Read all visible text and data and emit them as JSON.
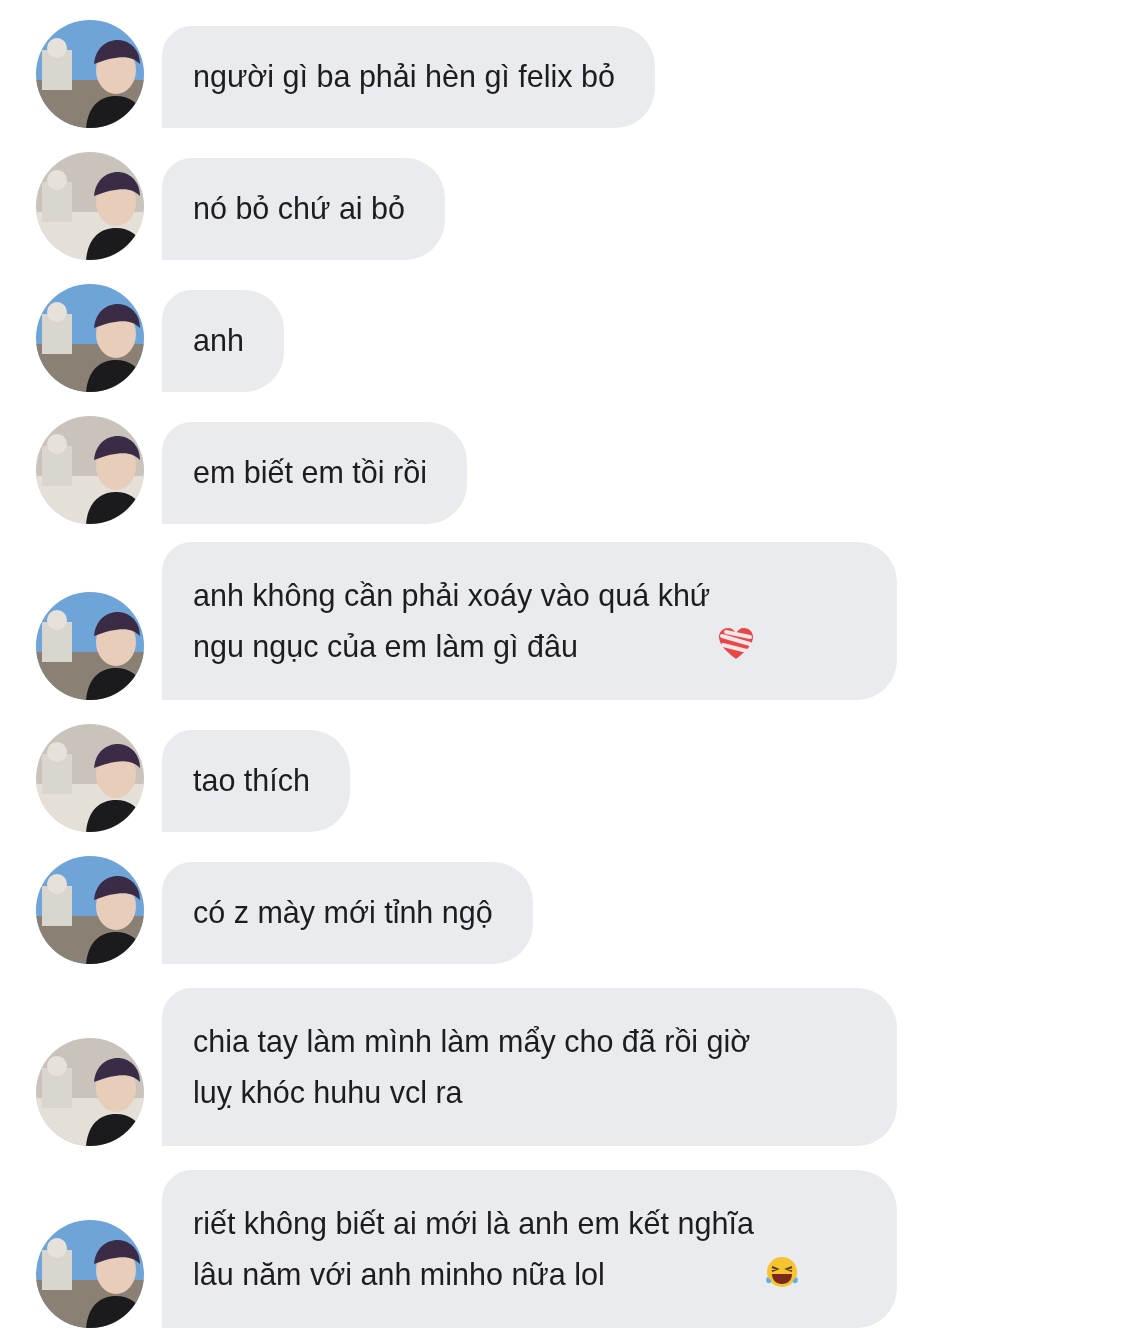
{
  "messages": [
    {
      "kind": "plain",
      "text": "người gì ba phải hèn gì felix bỏ"
    },
    {
      "kind": "plain",
      "text": "nó bỏ chứ ai bỏ"
    },
    {
      "kind": "plain",
      "text": "anh"
    },
    {
      "kind": "plain",
      "text": "em biết em tồi rồi"
    },
    {
      "kind": "heart",
      "text": "anh không cần phải xoáy vào quá khứ\nngu ngục của em làm gì đâu"
    },
    {
      "kind": "plain",
      "text": "tao thích"
    },
    {
      "kind": "plain",
      "text": "có z mày mới tỉnh ngộ"
    },
    {
      "kind": "plain",
      "text": "chia tay làm mình làm mẩy cho đã rồi giờ\nluỵ khóc huhu vcl ra"
    },
    {
      "kind": "laughing",
      "text": "riết không biết ai mới là anh em kết nghĩa\nlâu năm với anh minho nữa lol"
    }
  ]
}
